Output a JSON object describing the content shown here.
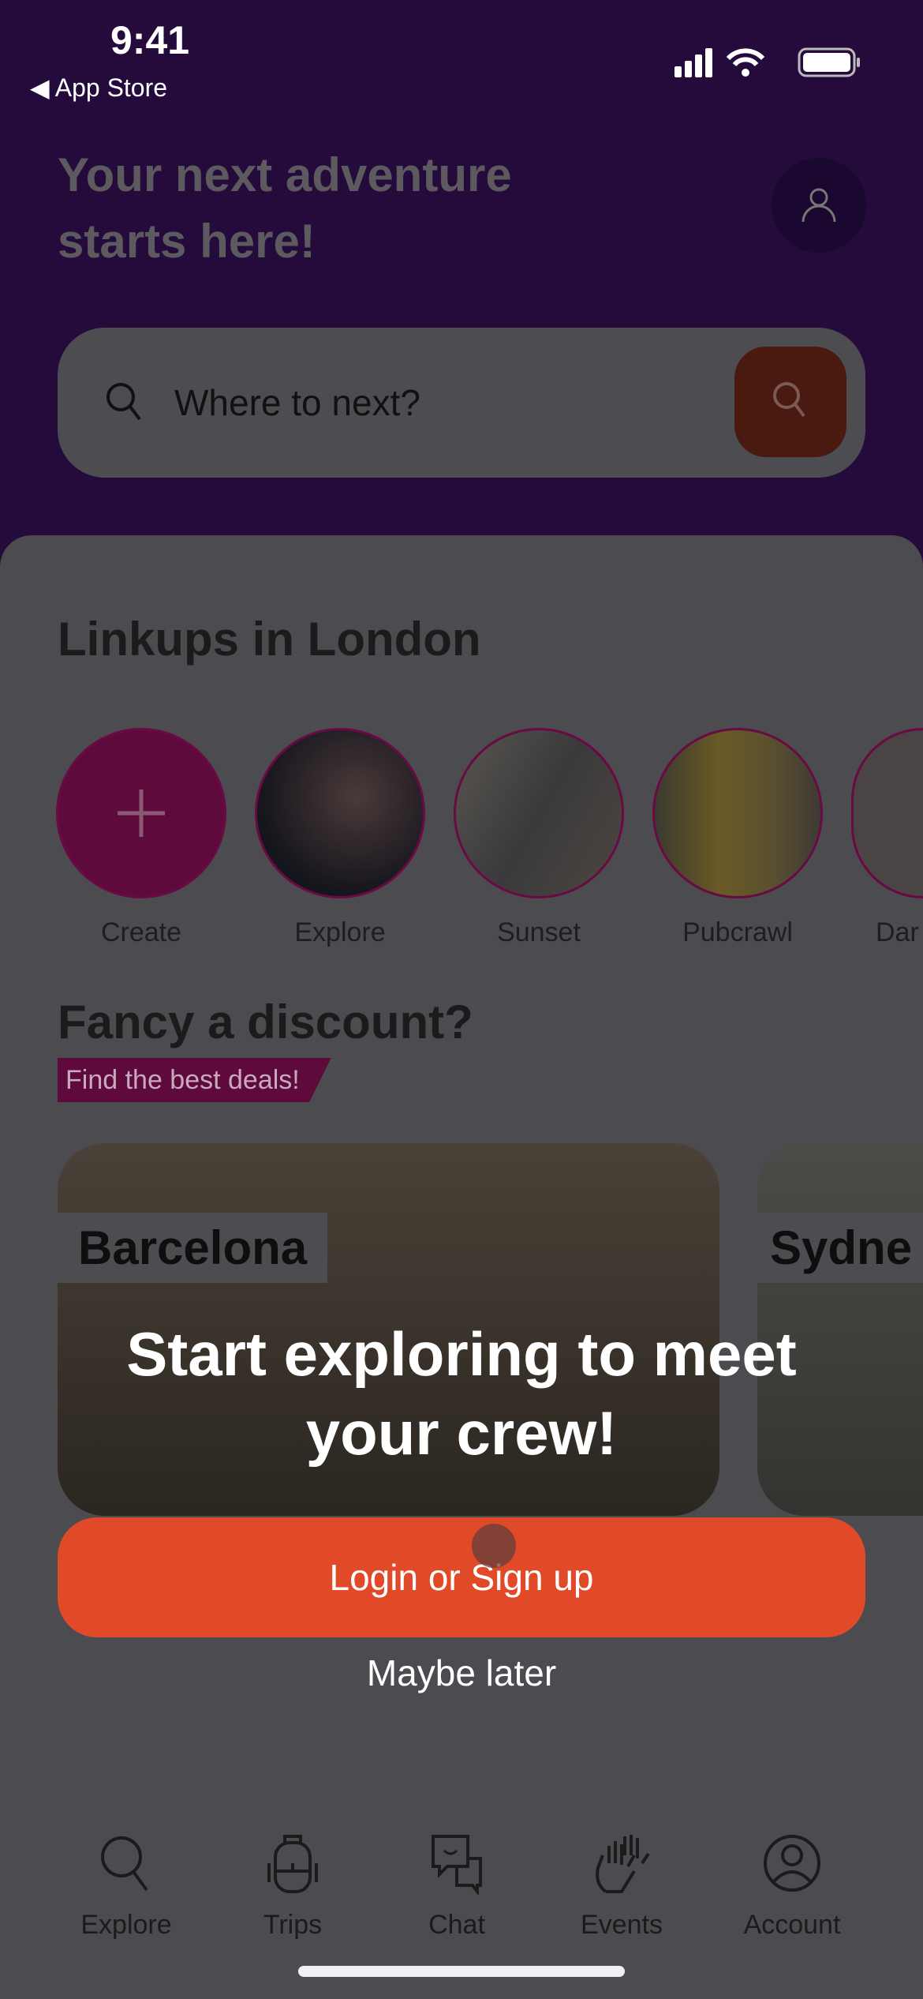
{
  "status_bar": {
    "time": "9:41",
    "back_label": "App Store"
  },
  "header": {
    "title_line1": "Your next adventure",
    "title_line2": "starts here!"
  },
  "search": {
    "placeholder": "Where to next?"
  },
  "linkups": {
    "title": "Linkups in London",
    "items": [
      {
        "label": "Create"
      },
      {
        "label": "Explore"
      },
      {
        "label": "Sunset"
      },
      {
        "label": "Pubcrawl"
      },
      {
        "label": "Dar"
      }
    ]
  },
  "discount": {
    "title": "Fancy a discount?",
    "badge": "Find the best deals!",
    "cards": [
      {
        "label": "Barcelona"
      },
      {
        "label": "Sydne"
      }
    ]
  },
  "prompt": {
    "message": "Start exploring to meet your crew!",
    "login_label": "Login or Sign up",
    "later_label": "Maybe later"
  },
  "tabs": [
    {
      "label": "Explore",
      "icon": "search-icon"
    },
    {
      "label": "Trips",
      "icon": "backpack-icon"
    },
    {
      "label": "Chat",
      "icon": "chat-icon"
    },
    {
      "label": "Events",
      "icon": "high-five-icon"
    },
    {
      "label": "Account",
      "icon": "account-icon"
    }
  ],
  "colors": {
    "header_bg": "#240b3c",
    "accent": "#e04a28",
    "brand_magenta": "#6a0a45"
  }
}
